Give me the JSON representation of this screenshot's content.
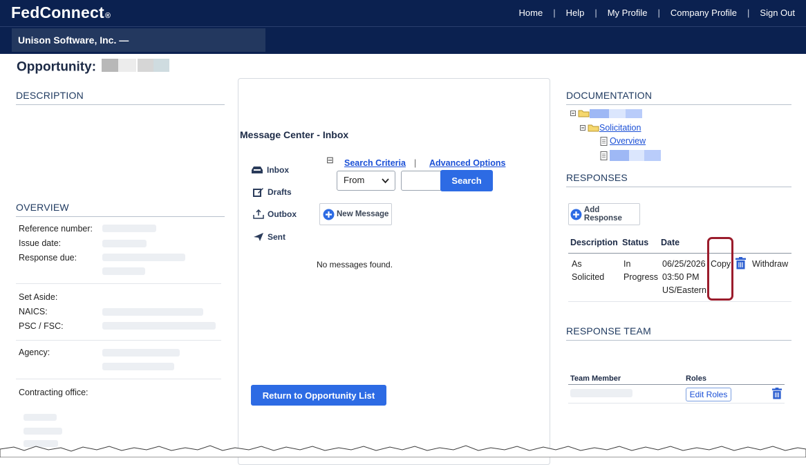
{
  "header": {
    "logo_text": "FedConnect",
    "logo_mark": "®",
    "nav": [
      "Home",
      "Help",
      "My Profile",
      "Company Profile",
      "Sign Out"
    ],
    "separator": "|",
    "company_name": "Unison Software, Inc. —"
  },
  "page": {
    "title": "Opportunity:"
  },
  "left": {
    "description_heading": "DESCRIPTION",
    "overview_heading": "OVERVIEW",
    "fields": {
      "reference_number": "Reference number:",
      "issue_date": "Issue date:",
      "response_due": "Response due:",
      "set_aside": "Set Aside:",
      "naics": "NAICS:",
      "psc_fsc": "PSC / FSC:",
      "agency": "Agency:",
      "contracting_office": "Contracting office:"
    }
  },
  "message_center": {
    "title": "Message Center - Inbox",
    "folders": [
      "Inbox",
      "Drafts",
      "Outbox",
      "Sent"
    ],
    "search_criteria_label": "Search Criteria",
    "advanced_options_label": "Advanced Options",
    "collapse_glyph": "⊟",
    "pipe": "|",
    "select_value": "From",
    "search_button": "Search",
    "new_message_button": "New Message",
    "empty_text": "No messages found.",
    "return_button": "Return to Opportunity List"
  },
  "right": {
    "documentation_heading": "DOCUMENTATION",
    "tree": {
      "solicitation": "Solicitation",
      "overview": "Overview"
    },
    "responses_heading": "RESPONSES",
    "add_response_button": "Add Response",
    "table_headers": [
      "Description",
      "Status",
      "Date"
    ],
    "row": {
      "description": [
        "As",
        "Solicited"
      ],
      "status": [
        "In",
        "Progress"
      ],
      "date": [
        "06/25/2026",
        "03:50 PM",
        "US/Eastern"
      ],
      "copy_label": "Copy",
      "withdraw_label": "Withdraw"
    },
    "response_team_heading": "RESPONSE TEAM",
    "team_headers": [
      "Team Member",
      "Roles"
    ],
    "edit_roles_button": "Edit Roles"
  },
  "colors": {
    "header_bg": "#0b2150",
    "primary_button": "#2d6be4",
    "link": "#1a4fd6",
    "highlight": "#9b1c2c"
  }
}
